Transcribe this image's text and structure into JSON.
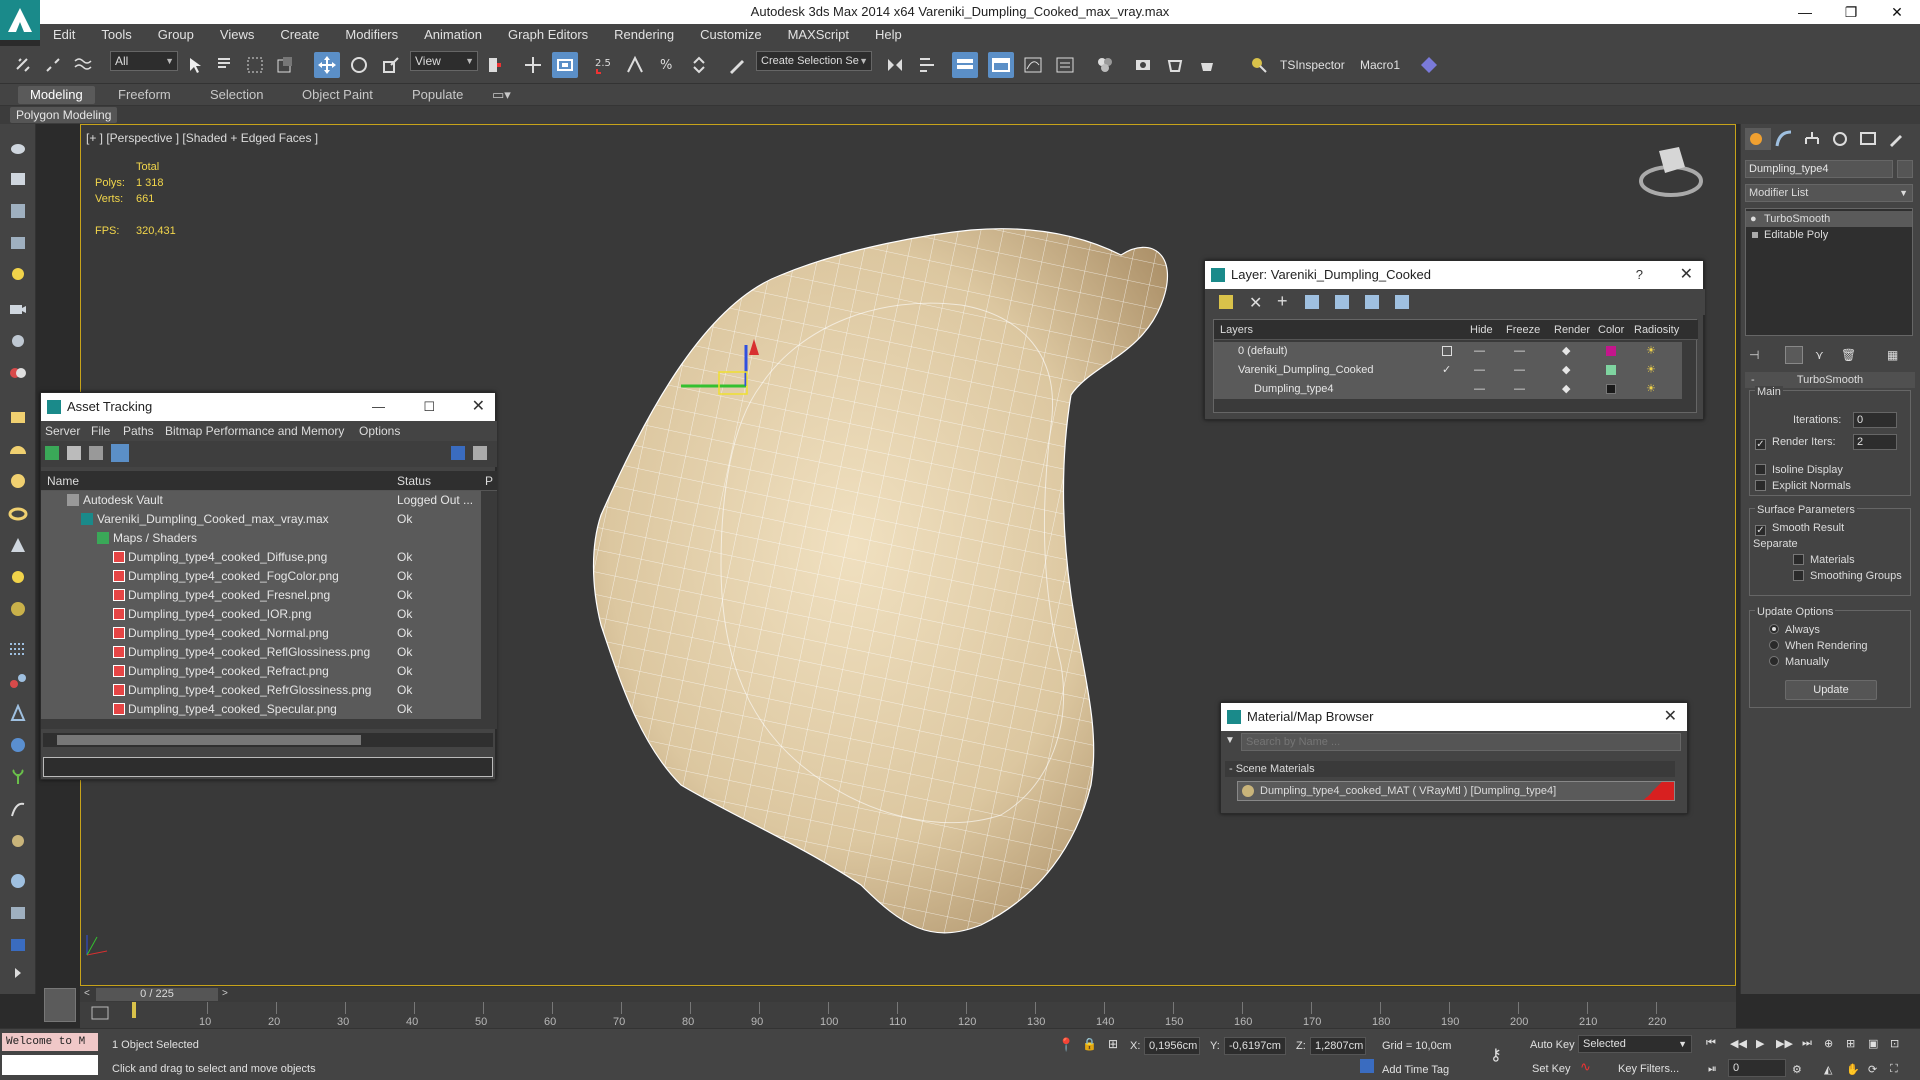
{
  "window": {
    "app_title": "Autodesk 3ds Max  2014 x64    Vareniki_Dumpling_Cooked_max_vray.max",
    "minimize": "—",
    "maximize": "❐",
    "close": "✕"
  },
  "menu": [
    "Edit",
    "Tools",
    "Group",
    "Views",
    "Create",
    "Modifiers",
    "Animation",
    "Graph Editors",
    "Rendering",
    "Customize",
    "MAXScript",
    "Help"
  ],
  "toolbar": {
    "selection_filter": "All",
    "reference_coord": "View",
    "snap_value": "2.5",
    "named_selection": "Create Selection Se",
    "tsinspector": "TSInspector",
    "macro": "Macro1"
  },
  "ribbon": {
    "tabs": [
      "Modeling",
      "Freeform",
      "Selection",
      "Object Paint",
      "Populate"
    ],
    "sub": "Polygon Modeling"
  },
  "viewport": {
    "label": "[+ ] [Perspective ] [Shaded + Edged Faces ]",
    "stats_header": "Total",
    "polys_label": "Polys:",
    "polys_value": "1 318",
    "verts_label": "Verts:",
    "verts_value": "661",
    "fps_label": "FPS:",
    "fps_value": "320,431"
  },
  "asset_tracking": {
    "title": "Asset Tracking",
    "menu": [
      "Server",
      "File",
      "Paths",
      "Bitmap Performance and Memory",
      "Options"
    ],
    "col_name": "Name",
    "col_status": "Status",
    "col_extra": "P",
    "rows": [
      {
        "name": "Autodesk Vault",
        "status": "Logged Out ..."
      },
      {
        "name": "Vareniki_Dumpling_Cooked_max_vray.max",
        "status": "Ok"
      },
      {
        "name": "Maps / Shaders",
        "status": ""
      },
      {
        "name": "Dumpling_type4_cooked_Diffuse.png",
        "status": "Ok"
      },
      {
        "name": "Dumpling_type4_cooked_FogColor.png",
        "status": "Ok"
      },
      {
        "name": "Dumpling_type4_cooked_Fresnel.png",
        "status": "Ok"
      },
      {
        "name": "Dumpling_type4_cooked_IOR.png",
        "status": "Ok"
      },
      {
        "name": "Dumpling_type4_cooked_Normal.png",
        "status": "Ok"
      },
      {
        "name": "Dumpling_type4_cooked_ReflGlossiness.png",
        "status": "Ok"
      },
      {
        "name": "Dumpling_type4_cooked_Refract.png",
        "status": "Ok"
      },
      {
        "name": "Dumpling_type4_cooked_RefrGlossiness.png",
        "status": "Ok"
      },
      {
        "name": "Dumpling_type4_cooked_Specular.png",
        "status": "Ok"
      }
    ]
  },
  "layer_dialog": {
    "title": "Layer: Vareniki_Dumpling_Cooked",
    "help": "?",
    "cols": [
      "Layers",
      "Hide",
      "Freeze",
      "Render",
      "Color",
      "Radiosity"
    ],
    "rows": [
      {
        "name": "0 (default)",
        "color": "#c4168c"
      },
      {
        "name": "Vareniki_Dumpling_Cooked",
        "color": "#7fd4a0"
      },
      {
        "name": "Dumpling_type4",
        "color": "#1a1a1a"
      }
    ]
  },
  "material_browser": {
    "title": "Material/Map Browser",
    "search_placeholder": "Search by Name ...",
    "section": "- Scene Materials",
    "item": "Dumpling_type4_cooked_MAT ( VRayMtl ) [Dumpling_type4]"
  },
  "command_panel": {
    "object_name": "Dumpling_type4",
    "modifier_list": "Modifier List",
    "stack": [
      "TurboSmooth",
      "Editable Poly"
    ],
    "rollout_title": "TurboSmooth",
    "main_label": "Main",
    "iterations_label": "Iterations:",
    "iterations_value": "0",
    "render_iters_label": "Render Iters:",
    "render_iters_value": "2",
    "isoline": "Isoline Display",
    "explicit_normals": "Explicit Normals",
    "surface_params": "Surface Parameters",
    "smooth_result": "Smooth Result",
    "separate": "Separate",
    "materials": "Materials",
    "smoothing_groups": "Smoothing Groups",
    "update_options": "Update Options",
    "always": "Always",
    "when_rendering": "When Rendering",
    "manually": "Manually",
    "update_button": "Update"
  },
  "timeline": {
    "frame": "0 / 225",
    "ticks": [
      "10",
      "20",
      "30",
      "40",
      "50",
      "60",
      "70",
      "80",
      "90",
      "100",
      "110",
      "120",
      "130",
      "140",
      "150",
      "160",
      "170",
      "180",
      "190",
      "200",
      "210",
      "220"
    ]
  },
  "status": {
    "script_box": "Welcome to M",
    "selected": "1 Object Selected",
    "hint": "Click and drag to select and move objects",
    "x_label": "X:",
    "x_value": "0,1956cm",
    "y_label": "Y:",
    "y_value": "-0,6197cm",
    "z_label": "Z:",
    "z_value": "1,2807cm",
    "grid": "Grid = 10,0cm",
    "add_time_tag": "Add Time Tag",
    "auto_key": "Auto Key",
    "set_key": "Set Key",
    "key_mode": "Selected",
    "key_filters": "Key Filters...",
    "current_frame": "0"
  }
}
